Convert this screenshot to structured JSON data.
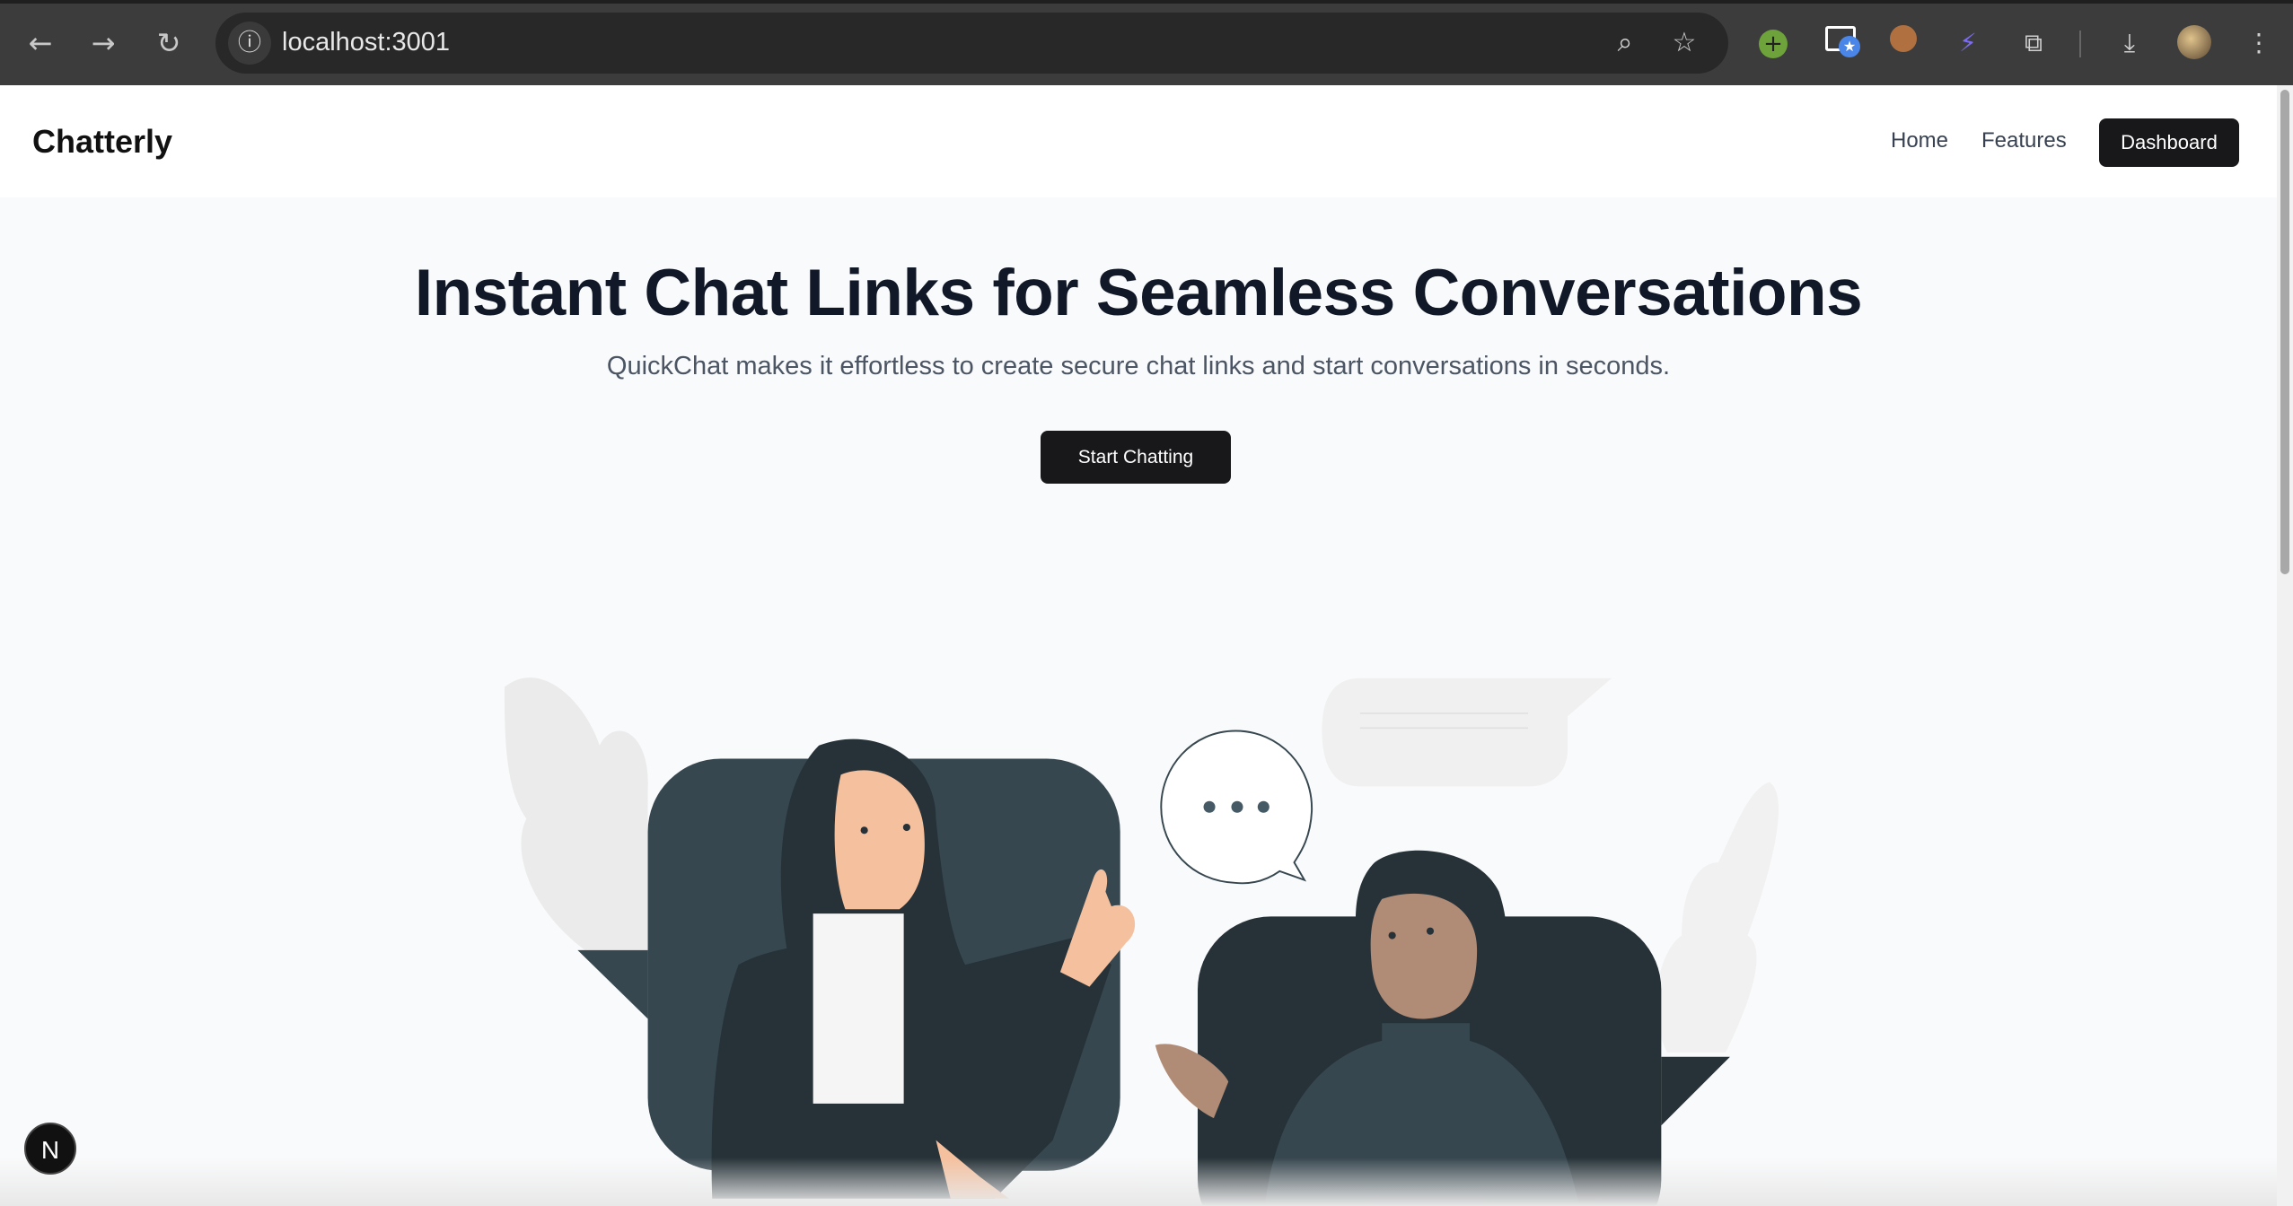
{
  "browser": {
    "url": "localhost:3001",
    "icons": [
      "back-icon",
      "forward-icon",
      "reload-icon",
      "info-icon",
      "zoom-icon",
      "bookmark-star-icon",
      "extension-add-icon",
      "extension-window-icon",
      "extension-cookie-icon",
      "extension-bolt-icon",
      "extensions-puzzle-icon",
      "download-icon",
      "profile-avatar",
      "menu-kebab-icon"
    ]
  },
  "nav": {
    "brand": "Chatterly",
    "links": [
      "Home",
      "Features"
    ],
    "dashboard_label": "Dashboard"
  },
  "hero": {
    "title": "Instant Chat Links for Seamless Conversations",
    "subtitle": "QuickChat makes it effortless to create secure chat links and start conversations in seconds.",
    "cta_label": "Start Chatting"
  },
  "dev_badge": "N",
  "colors": {
    "primary": "#18181b",
    "title": "#111827",
    "illustration_dark": "#263238",
    "illustration_slate": "#37474f"
  }
}
